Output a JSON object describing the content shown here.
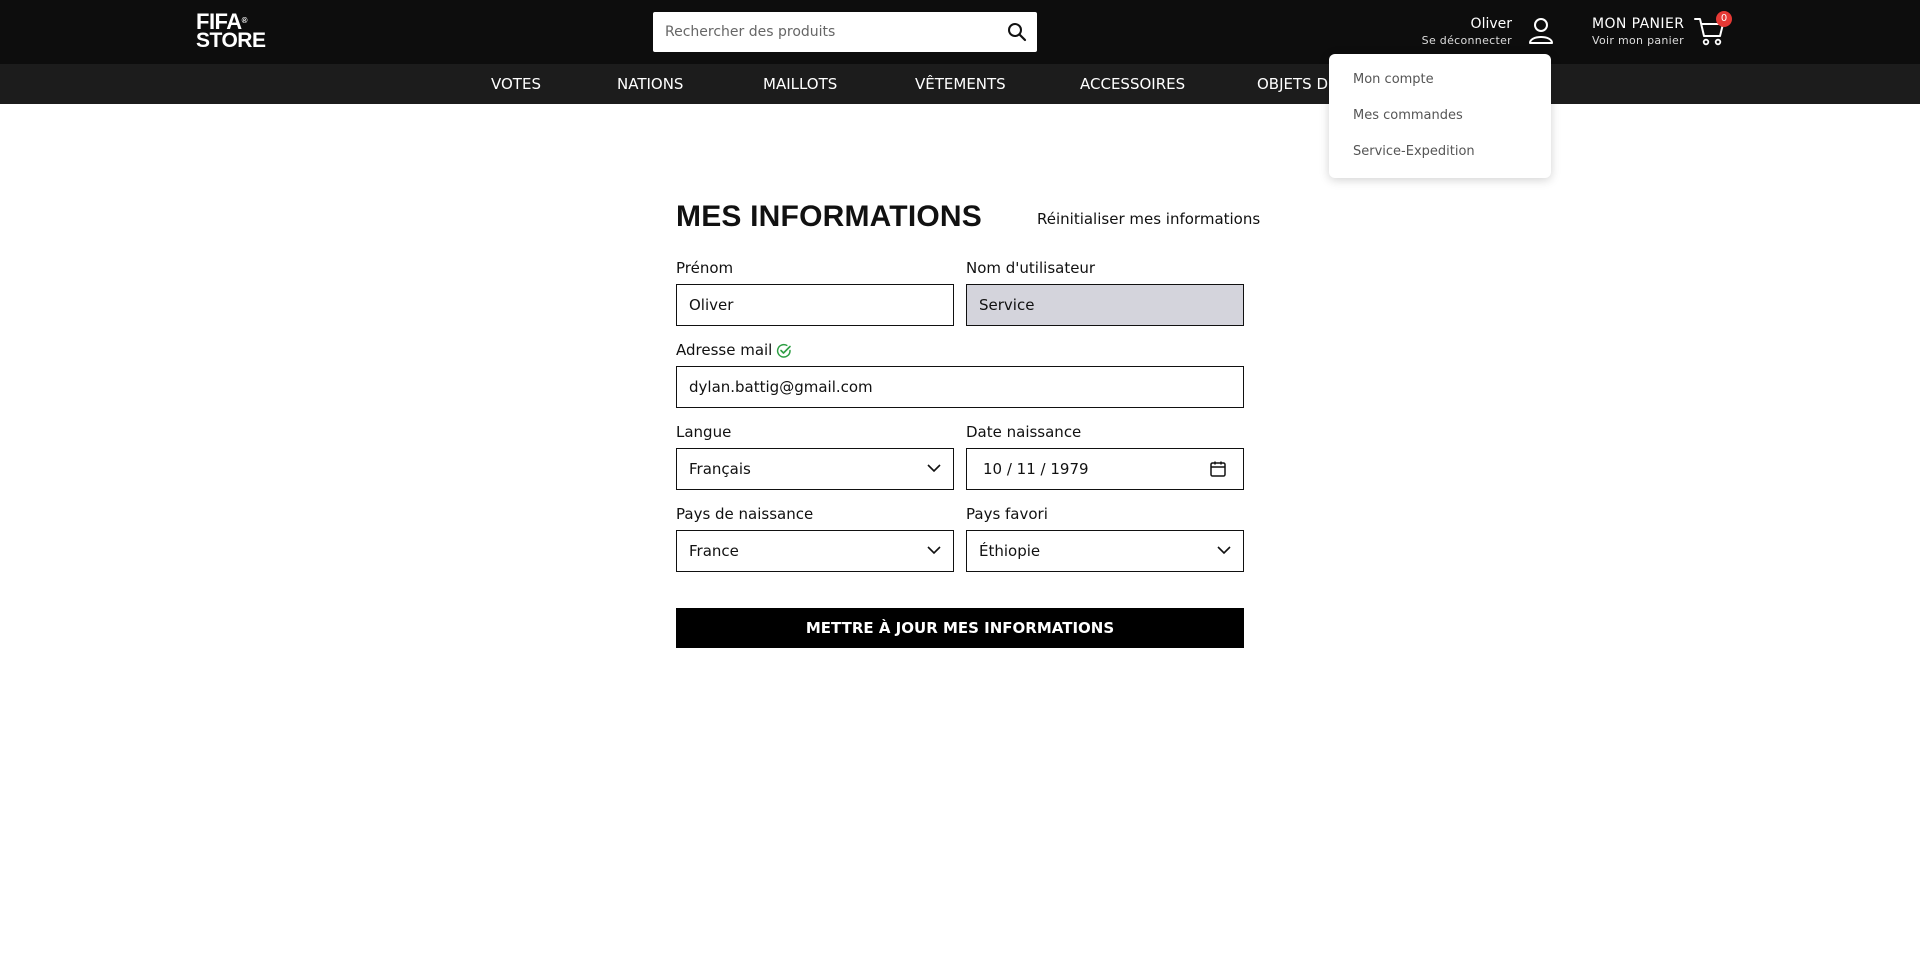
{
  "header": {
    "logo_line1": "FIFA",
    "logo_line2": "STORE",
    "logo_mark": "®",
    "search_placeholder": "Rechercher des produits",
    "user_name": "Oliver",
    "logout_label": "Se déconnecter",
    "cart_title": "MON PANIER",
    "cart_subtitle": "Voir mon panier",
    "cart_count": "0"
  },
  "nav": {
    "items": [
      "VOTES",
      "NATIONS",
      "MAILLOTS",
      "VÊTEMENTS",
      "ACCESSOIRES",
      "OBJETS DE"
    ]
  },
  "account_menu": {
    "items": [
      "Mon compte",
      "Mes commandes",
      "Service-Expedition"
    ]
  },
  "form": {
    "title": "MES INFORMATIONS",
    "reset_label": "Réinitialiser mes informations",
    "first_name_label": "Prénom",
    "first_name_value": "Oliver",
    "username_label": "Nom d'utilisateur",
    "username_value": "Service",
    "email_label": "Adresse mail",
    "email_value": "dylan.battig@gmail.com",
    "language_label": "Langue",
    "language_value": "Français",
    "birthdate_label": "Date naissance",
    "birthdate_value": "10 / 11 / 1979",
    "birth_country_label": "Pays de naissance",
    "birth_country_value": "France",
    "favorite_country_label": "Pays favori",
    "favorite_country_value": "Éthiopie",
    "submit_label": "METTRE À JOUR MES INFORMATIONS"
  },
  "colors": {
    "header_bg": "#0d0d0d",
    "nav_bg": "#1c1c1c",
    "badge": "#e53935",
    "verified": "#2e9e44",
    "disabled_field": "#d4d4dc"
  },
  "icons": [
    "search-icon",
    "user-icon",
    "cart-icon",
    "check-circle-icon",
    "chevron-down-icon",
    "calendar-icon"
  ]
}
